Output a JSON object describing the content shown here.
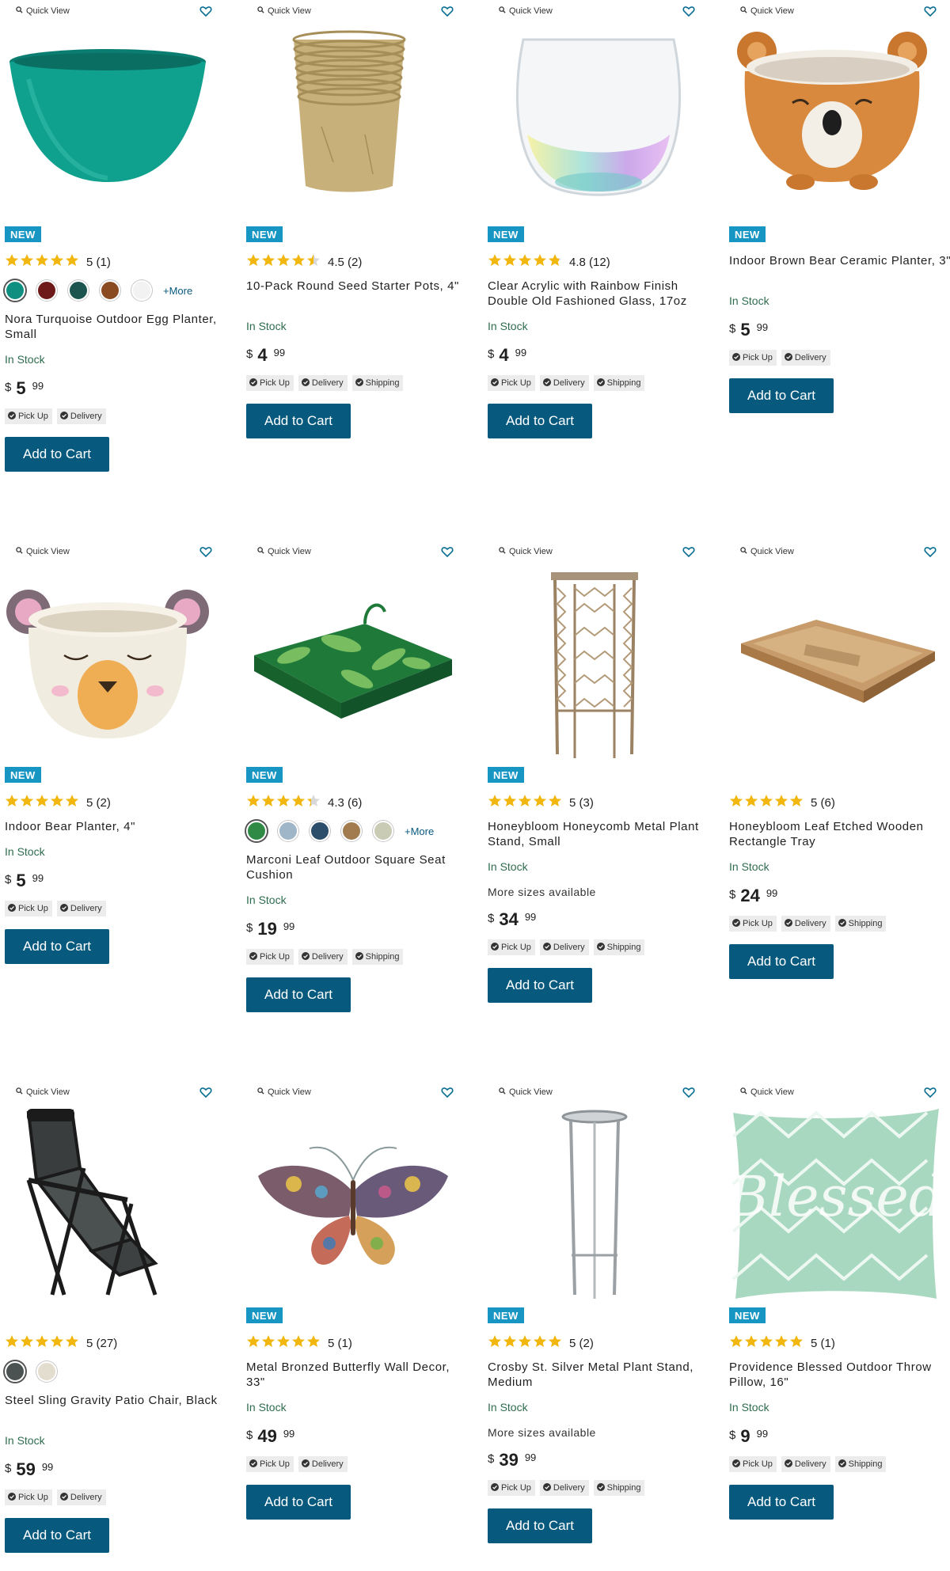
{
  "common": {
    "quick_view": "Quick View",
    "badge_new": "NEW",
    "in_stock": "In Stock",
    "more_sizes": "More sizes available",
    "add_to_cart": "Add to Cart",
    "currency": "$",
    "pick_up": "Pick Up",
    "delivery": "Delivery",
    "shipping": "Shipping",
    "more_swatches": "+More"
  },
  "colors": {
    "accent": "#075a7e",
    "badge": "#1796c4",
    "star": "#f2b70f",
    "stock": "#2f6c4f"
  },
  "products": [
    {
      "title": "Nora Turquoise Outdoor Egg Planter, Small",
      "rating": 5,
      "rating_text": "5 (1)",
      "price_dollars": "5",
      "price_cents": "99",
      "swatches": [
        "#0e8f7f",
        "#6e1a1a",
        "#1c5550",
        "#8a4a22",
        "#f2f2f2"
      ],
      "more_swatches": true,
      "fulfillment": [
        "pick_up",
        "delivery"
      ],
      "more_sizes": false,
      "image": "turquoise-planter"
    },
    {
      "title": "10-Pack Round Seed Starter Pots, 4\"",
      "rating": 4.5,
      "rating_text": "4.5 (2)",
      "price_dollars": "4",
      "price_cents": "99",
      "swatches": [],
      "more_swatches": false,
      "fulfillment": [
        "pick_up",
        "delivery",
        "shipping"
      ],
      "more_sizes": false,
      "image": "seed-pots"
    },
    {
      "title": "Clear Acrylic with Rainbow Finish Double Old Fashioned Glass, 17oz",
      "rating": 4.8,
      "rating_text": "4.8 (12)",
      "price_dollars": "4",
      "price_cents": "99",
      "swatches": [],
      "more_swatches": false,
      "fulfillment": [
        "pick_up",
        "delivery",
        "shipping"
      ],
      "more_sizes": false,
      "image": "rainbow-glass"
    },
    {
      "title": "Indoor Brown Bear Ceramic Planter, 3\"",
      "rating": null,
      "rating_text": "",
      "price_dollars": "5",
      "price_cents": "99",
      "swatches": [],
      "more_swatches": false,
      "fulfillment": [
        "pick_up",
        "delivery"
      ],
      "more_sizes": false,
      "image": "brown-bear-planter"
    },
    {
      "title": "Indoor Bear Planter, 4\"",
      "rating": 5,
      "rating_text": "5 (2)",
      "price_dollars": "5",
      "price_cents": "99",
      "swatches": [],
      "more_swatches": false,
      "fulfillment": [
        "pick_up",
        "delivery"
      ],
      "more_sizes": false,
      "image": "white-bear-planter"
    },
    {
      "title": "Marconi Leaf Outdoor Square Seat Cushion",
      "rating": 4.3,
      "rating_text": "4.3 (6)",
      "price_dollars": "19",
      "price_cents": "99",
      "swatches": [
        "#2f8a46",
        "#9fb6c9",
        "#2d4e6a",
        "#a27c4f",
        "#c9cbb4"
      ],
      "more_swatches": true,
      "fulfillment": [
        "pick_up",
        "delivery",
        "shipping"
      ],
      "more_sizes": false,
      "image": "leaf-cushion"
    },
    {
      "title": "Honeybloom Honeycomb Metal Plant Stand, Small",
      "rating": 5,
      "rating_text": "5 (3)",
      "price_dollars": "34",
      "price_cents": "99",
      "swatches": [],
      "more_swatches": false,
      "fulfillment": [
        "pick_up",
        "delivery",
        "shipping"
      ],
      "more_sizes": true,
      "image": "honeycomb-stand"
    },
    {
      "title": "Honeybloom Leaf Etched Wooden Rectangle Tray",
      "rating": 5,
      "rating_text": "5 (6)",
      "price_dollars": "24",
      "price_cents": "99",
      "swatches": [],
      "more_swatches": false,
      "fulfillment": [
        "pick_up",
        "delivery",
        "shipping"
      ],
      "more_sizes": false,
      "image": "wooden-tray"
    },
    {
      "title": "Steel Sling Gravity Patio Chair, Black",
      "rating": 5,
      "rating_text": "5 (27)",
      "price_dollars": "59",
      "price_cents": "99",
      "swatches": [
        "#4a5252",
        "#e3ddcf"
      ],
      "more_swatches": false,
      "fulfillment": [
        "pick_up",
        "delivery"
      ],
      "more_sizes": false,
      "image": "gravity-chair"
    },
    {
      "title": "Metal Bronzed Butterfly Wall Decor, 33\"",
      "rating": 5,
      "rating_text": "5 (1)",
      "price_dollars": "49",
      "price_cents": "99",
      "swatches": [],
      "more_swatches": false,
      "fulfillment": [
        "pick_up",
        "delivery"
      ],
      "more_sizes": false,
      "image": "butterfly-decor"
    },
    {
      "title": "Crosby St. Silver Metal Plant Stand, Medium",
      "rating": 5,
      "rating_text": "5 (2)",
      "price_dollars": "39",
      "price_cents": "99",
      "swatches": [],
      "more_swatches": false,
      "fulfillment": [
        "pick_up",
        "delivery",
        "shipping"
      ],
      "more_sizes": true,
      "image": "silver-stand"
    },
    {
      "title": "Providence Blessed Outdoor Throw Pillow, 16\"",
      "rating": 5,
      "rating_text": "5 (1)",
      "price_dollars": "9",
      "price_cents": "99",
      "swatches": [],
      "more_swatches": false,
      "fulfillment": [
        "pick_up",
        "delivery",
        "shipping"
      ],
      "more_sizes": false,
      "image": "blessed-pillow",
      "image_text": "Blessed"
    }
  ]
}
